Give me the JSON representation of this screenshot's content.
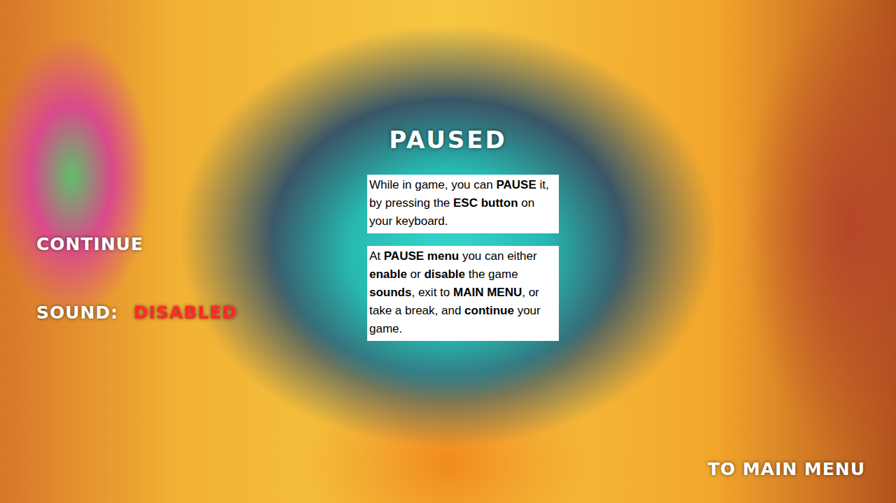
{
  "screen": {
    "title": "PAUSED"
  },
  "menu": {
    "continue": {
      "label": "CONTINUE"
    },
    "sound": {
      "label": "SOUND:",
      "value": "DISABLED",
      "enabled": false
    },
    "main_menu": {
      "label": "TO MAIN MENU"
    }
  },
  "info_boxes": [
    {
      "segments": [
        {
          "text": "While in game, you can ",
          "bold": false
        },
        {
          "text": "PAUSE",
          "bold": true
        },
        {
          "text": " it, by pressing the ",
          "bold": false
        },
        {
          "text": "ESC button",
          "bold": true
        },
        {
          "text": " on your keyboard.",
          "bold": false
        }
      ]
    },
    {
      "segments": [
        {
          "text": "At ",
          "bold": false
        },
        {
          "text": "PAUSE menu",
          "bold": true
        },
        {
          "text": " you can either ",
          "bold": false
        },
        {
          "text": "enable",
          "bold": true
        },
        {
          "text": " or ",
          "bold": false
        },
        {
          "text": "disable",
          "bold": true
        },
        {
          "text": " the game ",
          "bold": false
        },
        {
          "text": "sounds",
          "bold": true
        },
        {
          "text": ", exit to ",
          "bold": false
        },
        {
          "text": "MAIN MENU",
          "bold": true
        },
        {
          "text": ", or take a break, and ",
          "bold": false
        },
        {
          "text": "continue",
          "bold": true
        },
        {
          "text": " your game.",
          "bold": false
        }
      ]
    }
  ]
}
